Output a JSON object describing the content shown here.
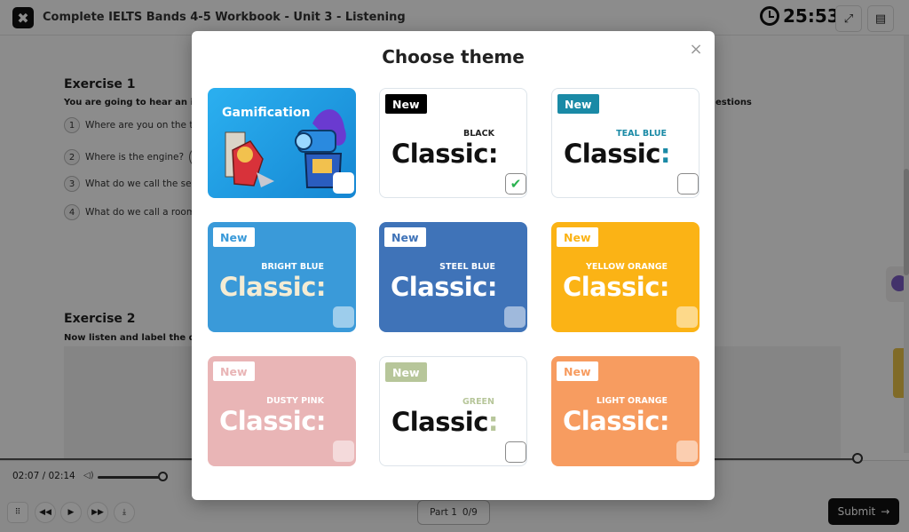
{
  "app": {
    "title": "Complete IELTS Bands 4-5 Workbook - Unit 3 - Listening",
    "timer": "25:53"
  },
  "exercise1": {
    "title": "Exercise 1",
    "instruction": "You are going to hear an info",
    "instruction_right": "estions",
    "questions": [
      {
        "num": "1",
        "text": "Where are you on the tra"
      },
      {
        "num": "2",
        "text": "Where is the engine?"
      },
      {
        "num": "3",
        "text": "What do we call the sepa"
      },
      {
        "num": "4",
        "text": "What do we call a room c"
      }
    ]
  },
  "exercise2": {
    "title": "Exercise 2",
    "instruction": "Now listen and label the diag"
  },
  "player": {
    "time": "02:07 / 02:14",
    "progress_fraction": 0.948,
    "volume_fraction": 0.92,
    "part_label": "Part 1",
    "part_count": "0/9",
    "submit_label": "Submit",
    "submit_arrow": "→"
  },
  "modal": {
    "title": "Choose theme",
    "close_symbol": "×",
    "cards": [
      {
        "id": "gamification",
        "label": "Gamification",
        "badge": "",
        "sub": "",
        "classic": "",
        "checked": false
      },
      {
        "id": "black",
        "badge": "New",
        "sub": "BLACK",
        "classic": "Classic:",
        "checked": true,
        "check_mark": "✔"
      },
      {
        "id": "teal-blue",
        "badge": "New",
        "sub": "TEAL BLUE",
        "classic": "Classic:",
        "checked": false
      },
      {
        "id": "bright-blue",
        "badge": "New",
        "sub": "BRIGHT BLUE",
        "classic": "Classic:",
        "checked": false
      },
      {
        "id": "steel-blue",
        "badge": "New",
        "sub": "STEEL BLUE",
        "classic": "Classic:",
        "checked": false
      },
      {
        "id": "yellow-orange",
        "badge": "New",
        "sub": "YELLOW ORANGE",
        "classic": "Classic:",
        "checked": false
      },
      {
        "id": "dusty-pink",
        "badge": "New",
        "sub": "DUSTY PINK",
        "classic": "Classic:",
        "checked": false
      },
      {
        "id": "green",
        "badge": "New",
        "sub": "GREEN",
        "classic": "Classic:",
        "checked": false
      },
      {
        "id": "light-orange",
        "badge": "New",
        "sub": "LIGHT ORANGE",
        "classic": "Classic:",
        "checked": false
      }
    ]
  },
  "colors": {
    "gamification_bg": "#1a9be0",
    "black_badge": "#000000",
    "teal": "#1a8aa6",
    "bright_blue": "#3a9ad9",
    "steel_blue": "#3f73b8",
    "yellow_orange": "#fbb315",
    "dusty_pink": "#e9b5b6",
    "green": "#b7c69a",
    "light_orange": "#f79c60",
    "check_green": "#2ab24f"
  }
}
